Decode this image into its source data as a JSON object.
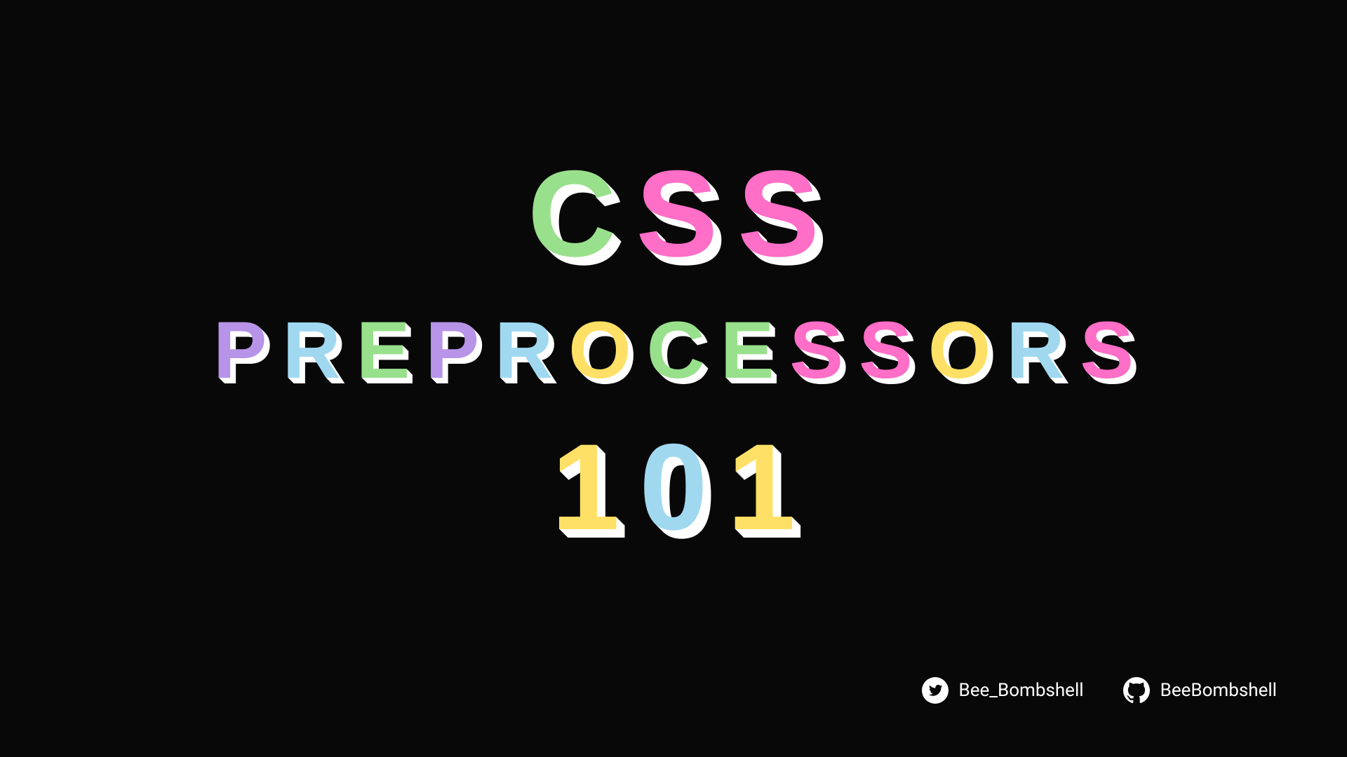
{
  "title": {
    "line1": [
      {
        "char": "C",
        "color": "green"
      },
      {
        "char": "S",
        "color": "pink"
      },
      {
        "char": "S",
        "color": "pink"
      }
    ],
    "line2": [
      {
        "char": "P",
        "color": "purple"
      },
      {
        "char": "R",
        "color": "blue"
      },
      {
        "char": "E",
        "color": "green"
      },
      {
        "char": "P",
        "color": "purple"
      },
      {
        "char": "R",
        "color": "blue"
      },
      {
        "char": "O",
        "color": "yellow"
      },
      {
        "char": "C",
        "color": "green"
      },
      {
        "char": "E",
        "color": "green"
      },
      {
        "char": "S",
        "color": "pink"
      },
      {
        "char": "S",
        "color": "pink"
      },
      {
        "char": "O",
        "color": "yellow"
      },
      {
        "char": "R",
        "color": "blue"
      },
      {
        "char": "S",
        "color": "pink"
      }
    ],
    "line3": [
      {
        "char": "1",
        "color": "yellow"
      },
      {
        "char": "0",
        "color": "blue"
      },
      {
        "char": "1",
        "color": "yellow"
      }
    ]
  },
  "social": {
    "twitter": "Bee_Bombshell",
    "github": "BeeBombshell"
  }
}
